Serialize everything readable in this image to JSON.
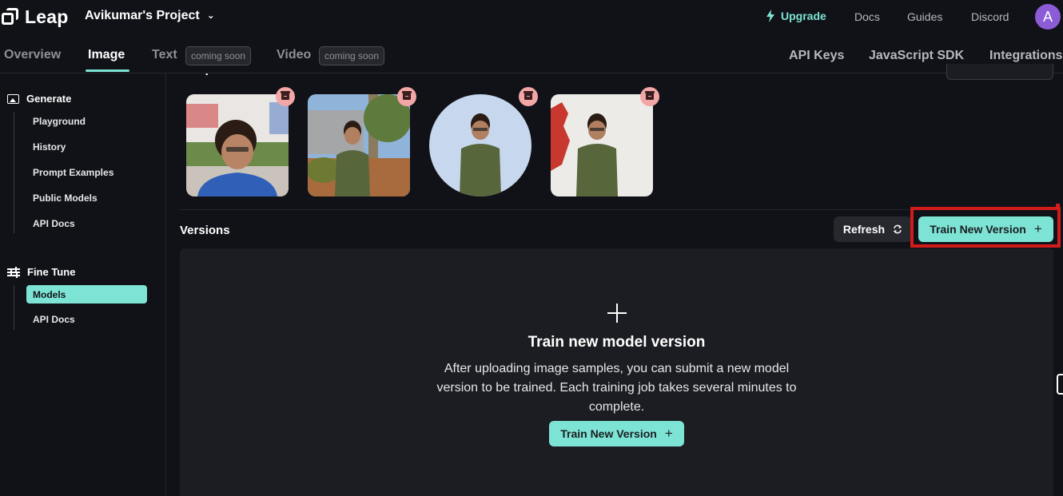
{
  "brand": {
    "name": "Leap"
  },
  "project": {
    "name": "Avikumar's Project"
  },
  "top_nav": {
    "upgrade": "Upgrade",
    "docs": "Docs",
    "guides": "Guides",
    "discord": "Discord",
    "avatar_initial": "A"
  },
  "tabs": {
    "overview": "Overview",
    "image": "Image",
    "text": "Text",
    "video": "Video",
    "coming_soon": "coming soon",
    "api_keys": "API Keys",
    "js_sdk": "JavaScript SDK",
    "integrations": "Integrations"
  },
  "sidebar": {
    "generate": {
      "title": "Generate",
      "items": [
        "Playground",
        "History",
        "Prompt Examples",
        "Public Models",
        "API Docs"
      ]
    },
    "fine_tune": {
      "title": "Fine Tune",
      "items": [
        "Models",
        "API Docs"
      ],
      "active": "Models"
    }
  },
  "samples": {
    "title": "Samples",
    "images": [
      {
        "shape": "rounded",
        "desc": "smiling person in blue t-shirt"
      },
      {
        "shape": "rounded",
        "desc": "person in olive shirt outdoors"
      },
      {
        "shape": "circle",
        "desc": "person in olive shirt on blue background"
      },
      {
        "shape": "rounded",
        "desc": "person in olive shirt against white wall"
      }
    ]
  },
  "versions": {
    "title": "Versions",
    "refresh": "Refresh",
    "train_button": "Train New Version",
    "empty_title": "Train new model version",
    "empty_desc": "After uploading image samples, you can submit a new model version to be trained. Each training job takes several minutes to complete.",
    "empty_button": "Train New Version"
  },
  "colors": {
    "accent": "#7de3d4",
    "background": "#111217",
    "panel": "#1c1d22",
    "highlight": "#d21c1c",
    "avatar": "#8b5cd6"
  }
}
